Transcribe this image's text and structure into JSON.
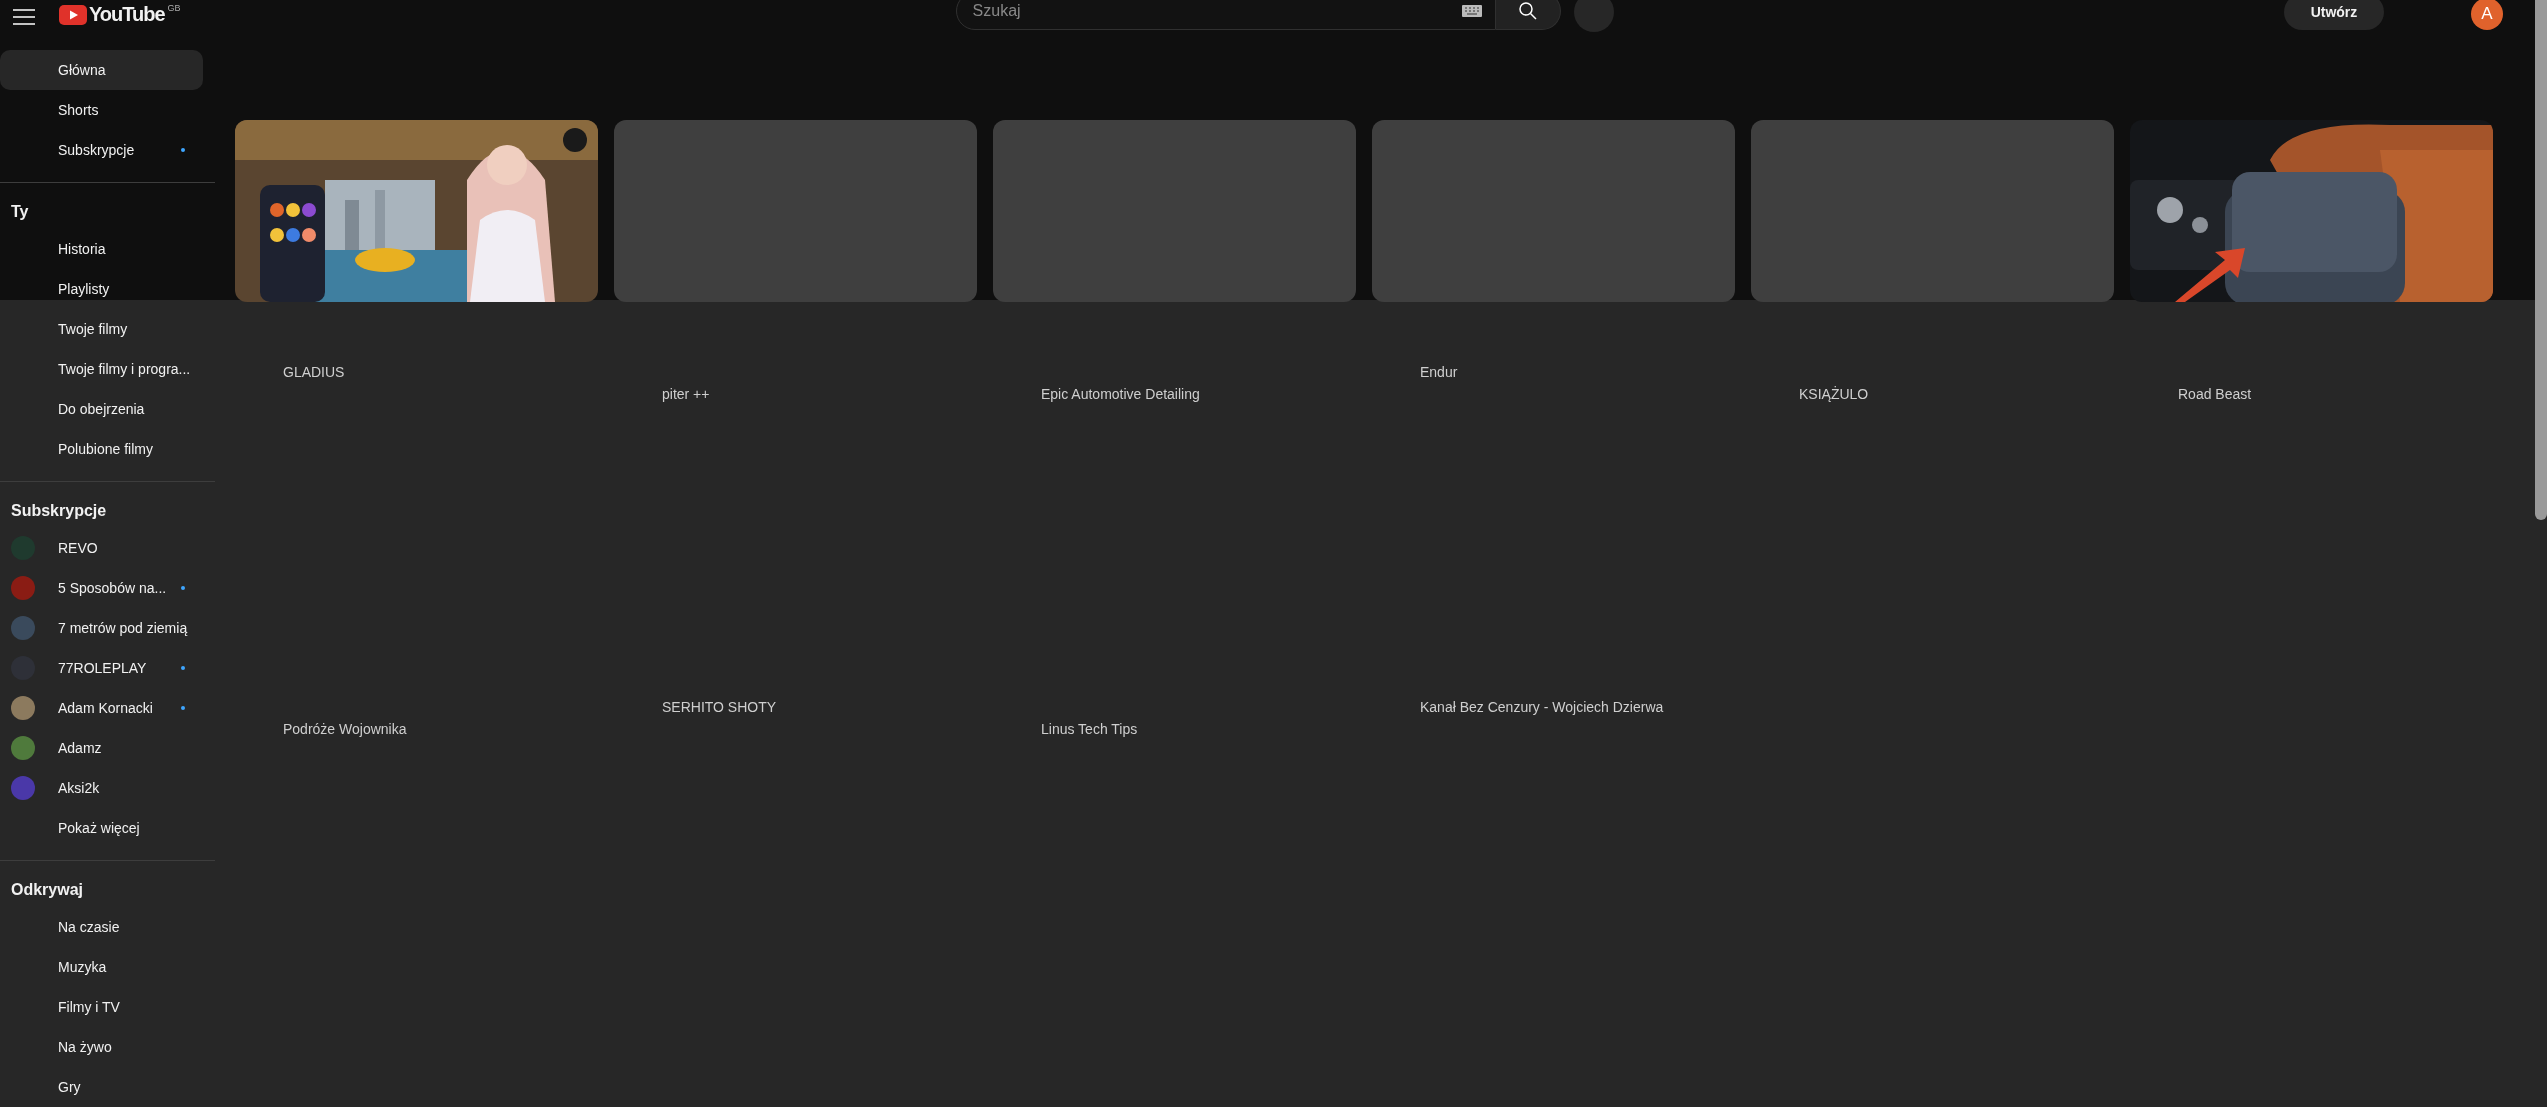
{
  "header": {
    "logo": "YouTube",
    "region": "GB",
    "search": {
      "placeholder": "Szukaj"
    },
    "create_button": "Utwórz",
    "avatar": "A"
  },
  "sidebar": {
    "sections": [
      {
        "items": [
          {
            "label": "Główna",
            "selected": true,
            "new": false
          },
          {
            "label": "Shorts",
            "selected": false,
            "new": false
          },
          {
            "label": "Subskrypcje",
            "selected": false,
            "new": true
          }
        ]
      },
      {
        "heading": "Ty",
        "items": [
          {
            "label": "Historia",
            "selected": false
          },
          {
            "label": "Playlisty",
            "selected": false
          },
          {
            "label": "Twoje filmy",
            "selected": false
          },
          {
            "label": "Twoje filmy i progra...",
            "selected": false
          },
          {
            "label": "Do obejrzenia",
            "selected": false
          },
          {
            "label": "Polubione filmy",
            "selected": false
          }
        ]
      },
      {
        "heading": "Subskrypcje",
        "items": [
          {
            "kind": "channel",
            "label": "REVO",
            "color": "#1f3a2e",
            "selected": false,
            "new": false
          },
          {
            "kind": "channel",
            "label": "5 Sposobów na...",
            "color": "#8a1c14",
            "selected": false,
            "new": true
          },
          {
            "kind": "channel",
            "label": "7 metrów pod ziemią",
            "color": "#3a4a5c",
            "selected": false,
            "new": false
          },
          {
            "kind": "channel",
            "label": "77ROLEPLAY",
            "color": "#2e3038",
            "selected": false,
            "new": true
          },
          {
            "kind": "channel",
            "label": "Adam Kornacki",
            "color": "#8c7a5e",
            "selected": false,
            "new": true
          },
          {
            "kind": "channel",
            "label": "Adamz",
            "color": "#4f7a3c",
            "selected": false,
            "new": false
          },
          {
            "kind": "channel",
            "label": "Aksi2k",
            "color": "#4a38a8",
            "selected": false,
            "new": false
          },
          {
            "kind": "more",
            "label": "Pokaż więcej",
            "selected": false,
            "new": false
          }
        ]
      },
      {
        "heading": "Odkrywaj",
        "items": [
          {
            "label": "Na czasie",
            "selected": false
          },
          {
            "label": "Muzyka",
            "selected": false
          },
          {
            "label": "Filmy i TV",
            "selected": false
          },
          {
            "label": "Na żywo",
            "selected": false
          },
          {
            "label": "Gry",
            "selected": false
          }
        ]
      }
    ]
  },
  "feed": [
    {
      "channel": "GLADIUS",
      "kind": "compact"
    },
    {
      "thumbnail": {
        "kind": "placeholder"
      },
      "channel": "piter ++",
      "kind": "tall"
    },
    {
      "thumbnail": {
        "kind": "placeholder"
      },
      "channel": "Epic Automotive Detailing",
      "kind": "tall"
    },
    {
      "thumbnail": {
        "kind": "placeholder"
      },
      "channel": "Endur",
      "kind": "compact"
    },
    {
      "thumbnail": {
        "kind": "placeholder"
      },
      "channel": "KSIĄŻULO",
      "kind": "tall"
    },
    {
      "channel": "Road Beast",
      "kind": "tall"
    },
    {
      "channel": "Podróże Wojownika",
      "kind": "tall"
    },
    {
      "channel": "SERHITO SHOTY",
      "kind": "compact"
    },
    {
      "channel": "Linus Tech Tips",
      "kind": "tall"
    },
    {
      "channel": "Kanał Bez Cenzury - Wojciech Dzierwa",
      "kind": "compact"
    }
  ]
}
